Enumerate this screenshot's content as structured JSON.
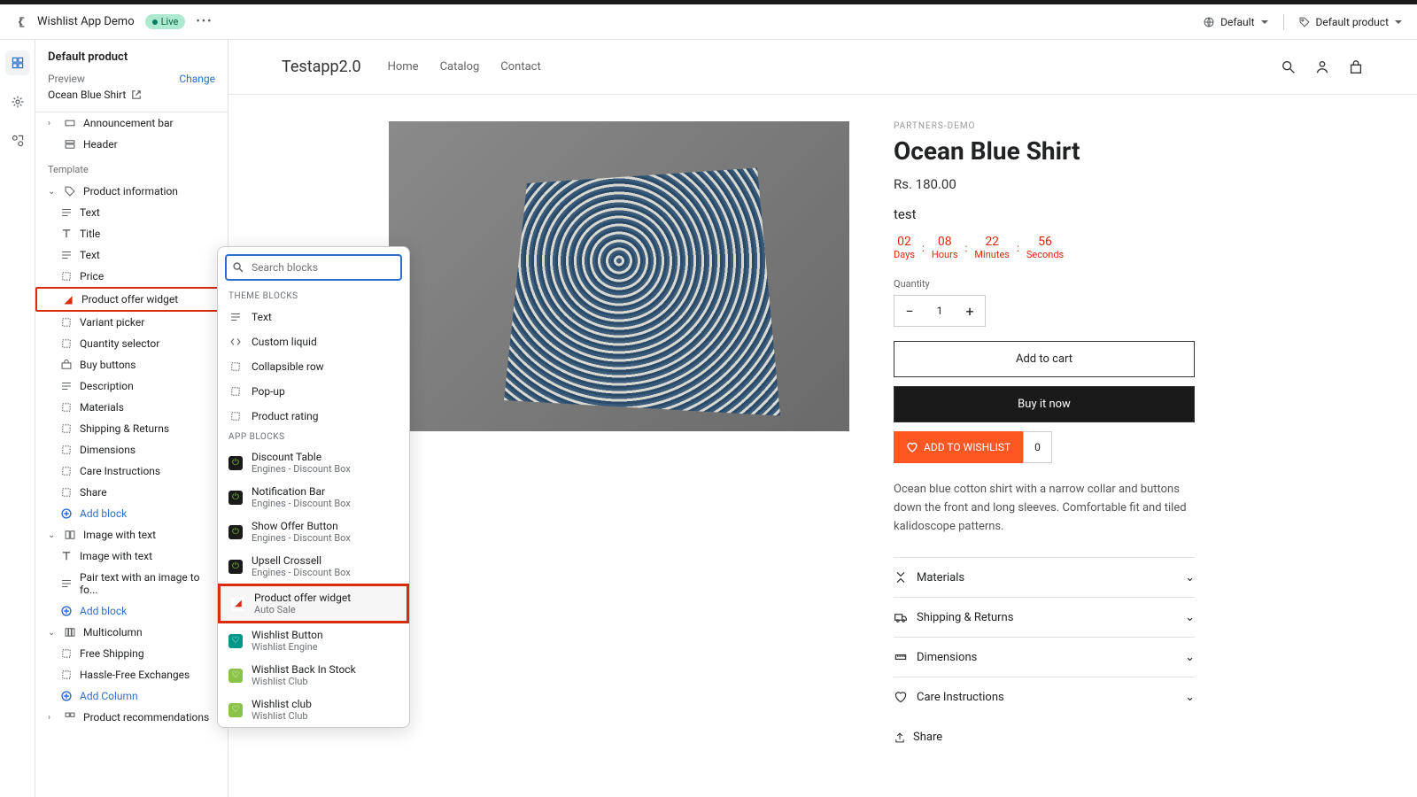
{
  "header": {
    "app_name": "Wishlist App Demo",
    "status": "Live",
    "locale_selector": "Default",
    "template_selector": "Default product"
  },
  "sidebar": {
    "title": "Default product",
    "preview_label": "Preview",
    "change_label": "Change",
    "preview_product": "Ocean Blue Shirt",
    "template_heading": "Template",
    "sections": {
      "announcement": "Announcement bar",
      "header": "Header",
      "product_info": "Product information",
      "image_text": "Image with text",
      "multicolumn": "Multicolumn",
      "recommendations": "Product recommendations"
    },
    "blocks": {
      "text1": "Text",
      "title": "Title",
      "text2": "Text",
      "price": "Price",
      "offer_widget": "Product offer widget",
      "variant": "Variant picker",
      "qty": "Quantity selector",
      "buy": "Buy buttons",
      "desc": "Description",
      "materials": "Materials",
      "shipping": "Shipping & Returns",
      "dimensions": "Dimensions",
      "care": "Care Instructions",
      "share": "Share",
      "img_text": "Image with text",
      "pair_text": "Pair text with an image to fo...",
      "free_ship": "Free Shipping",
      "hassle": "Hassle-Free Exchanges"
    },
    "add_block": "Add block",
    "add_column": "Add Column"
  },
  "popup": {
    "search_placeholder": "Search blocks",
    "theme_heading": "THEME BLOCKS",
    "app_heading": "APP BLOCKS",
    "theme_blocks": {
      "text": "Text",
      "liquid": "Custom liquid",
      "collapsible": "Collapsible row",
      "popup": "Pop-up",
      "rating": "Product rating"
    },
    "app_blocks": {
      "discount": {
        "name": "Discount Table",
        "vendor": "Engines - Discount Box"
      },
      "notif": {
        "name": "Notification Bar",
        "vendor": "Engines - Discount Box"
      },
      "offer_btn": {
        "name": "Show Offer Button",
        "vendor": "Engines - Discount Box"
      },
      "upsell": {
        "name": "Upsell Crossell",
        "vendor": "Engines - Discount Box"
      },
      "offer_widget": {
        "name": "Product offer widget",
        "vendor": "Auto Sale"
      },
      "wish_btn": {
        "name": "Wishlist Button",
        "vendor": "Wishlist Engine"
      },
      "wish_stock": {
        "name": "Wishlist Back In Stock",
        "vendor": "Wishlist Club"
      },
      "wish_club": {
        "name": "Wishlist club",
        "vendor": "Wishlist Club"
      }
    }
  },
  "site": {
    "brand": "Testapp2.0",
    "nav": {
      "home": "Home",
      "catalog": "Catalog",
      "contact": "Contact"
    }
  },
  "product": {
    "vendor": "PARTNERS-DEMO",
    "title": "Ocean Blue Shirt",
    "price": "Rs. 180.00",
    "test_label": "test",
    "countdown": {
      "days": {
        "val": "02",
        "label": "Days"
      },
      "hours": {
        "val": "08",
        "label": "Hours"
      },
      "minutes": {
        "val": "22",
        "label": "Minutes"
      },
      "seconds": {
        "val": "56",
        "label": "Seconds"
      }
    },
    "qty_label": "Quantity",
    "qty_value": "1",
    "add_cart": "Add to cart",
    "buy_now": "Buy it now",
    "wishlist": "ADD TO WISHLIST",
    "wishlist_count": "0",
    "description": "Ocean blue cotton shirt with a narrow collar and buttons down the front and long sleeves. Comfortable fit and tiled kalidoscope patterns.",
    "collapse": {
      "materials": "Materials",
      "shipping": "Shipping & Returns",
      "dimensions": "Dimensions",
      "care": "Care Instructions"
    },
    "share": "Share"
  }
}
